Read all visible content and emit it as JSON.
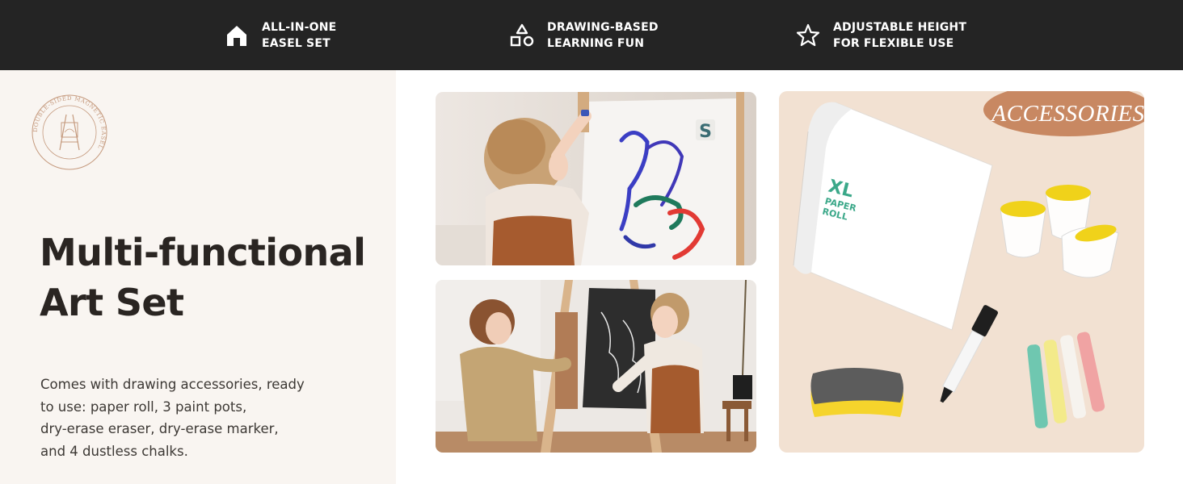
{
  "features": [
    {
      "icon": "house-icon",
      "line1": "ALL-IN-ONE",
      "line2": "EASEL SET"
    },
    {
      "icon": "shapes-icon",
      "line1": "DRAWING-BASED",
      "line2": "LEARNING FUN"
    },
    {
      "icon": "star-icon",
      "line1": "ADJUSTABLE HEIGHT",
      "line2": "FOR FLEXIBLE USE"
    }
  ],
  "seal_text": "DOUBLE-SIDED MAGNETIC EASEL",
  "headline": {
    "line1": "Multi-functional",
    "line2": "Art Set"
  },
  "description": {
    "line1": "Comes with drawing accessories, ready",
    "line2": "to use: paper roll, 3 paint pots,",
    "line3": "dry-erase eraser, dry-erase marker,",
    "line4": "and 4 dustless chalks."
  },
  "accessories": {
    "badge": "ACCESSORIES",
    "paper_label": {
      "line1": "XL",
      "line2": "PAPER",
      "line3": "ROLL"
    }
  },
  "photo1_letter": "S",
  "colors": {
    "topbar": "#242424",
    "left_panel": "#f9f5f1",
    "accessories_bg": "#f2e1d2",
    "badge": "#c88862",
    "headline": "#2a2522"
  }
}
